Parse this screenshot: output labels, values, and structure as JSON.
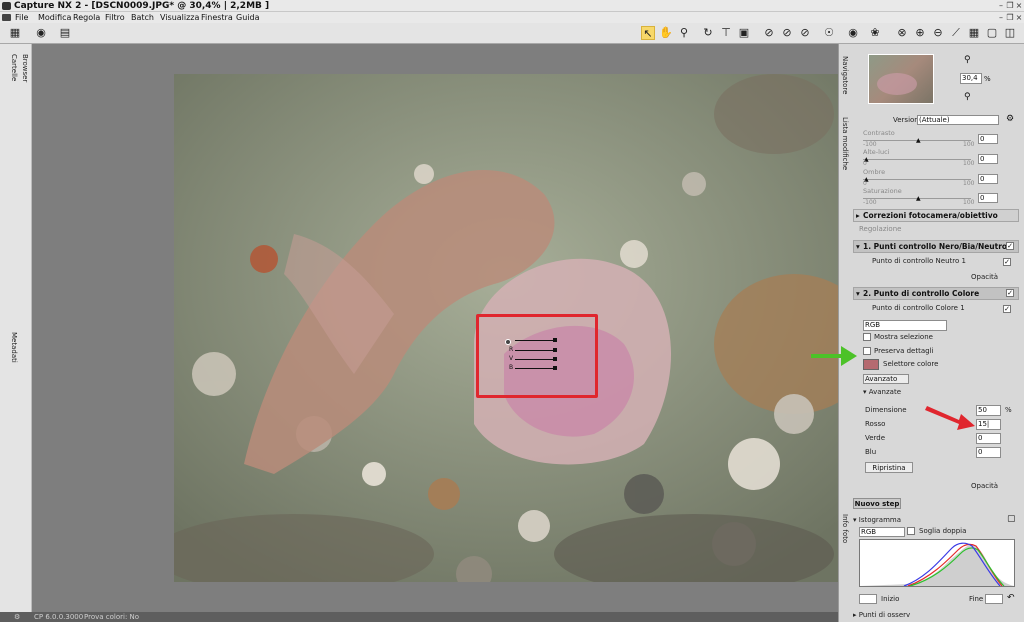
{
  "window": {
    "title": "Capture NX 2 - [DSCN0009.JPG* @ 30,4% | 2,2MB ]"
  },
  "menu": [
    "File",
    "Modifica",
    "Regola",
    "Filtro",
    "Batch",
    "Visualizza",
    "Finestra",
    "Guida"
  ],
  "left_strip": {
    "browser": "Browser",
    "cartelle": "Cartelle",
    "metadata": "Metadati"
  },
  "navigator": {
    "label": "Navigatore",
    "zoom_value": "30,4",
    "zoom_unit": "%"
  },
  "edit_list": {
    "label": "Lista modifiche",
    "version_label": "Versione:",
    "version_value": "(Attuale)",
    "sliders": [
      {
        "label": "Contrasto",
        "min": "-100",
        "max": "100",
        "value": "0"
      },
      {
        "label": "Alte-luci",
        "min": "0",
        "max": "100",
        "value": "0"
      },
      {
        "label": "Ombre",
        "min": "0",
        "max": "100",
        "value": "0"
      },
      {
        "label": "Saturazione",
        "min": "-100",
        "max": "100",
        "value": "0"
      }
    ],
    "lens_section": "Correzioni fotocamera/obiettivo",
    "adjust_label": "Regolazione",
    "step1": {
      "title": "1. Punti controllo Nero/Bia/Neutro",
      "item": "Punto di controllo Neutro 1",
      "opacity": "Opacità"
    },
    "step2": {
      "title": "2. Punto di controllo Colore",
      "item": "Punto di controllo Colore 1",
      "color_mode": "RGB",
      "show_selection": "Mostra selezione",
      "preserve_details": "Preserva dettagli",
      "color_picker": "Selettore colore",
      "advanced_dropdown": "Avanzato",
      "advanced_section": "Avanzate",
      "fields": [
        {
          "label": "Dimensione",
          "value": "50",
          "unit": "%"
        },
        {
          "label": "Rosso",
          "value": "15|",
          "unit": ""
        },
        {
          "label": "Verde",
          "value": "0",
          "unit": ""
        },
        {
          "label": "Blu",
          "value": "0",
          "unit": ""
        }
      ],
      "reset_button": "Ripristina",
      "opacity": "Opacità"
    },
    "new_step": "Nuovo step"
  },
  "info": {
    "label": "Info foto",
    "histogram": "Istogramma",
    "channel": "RGB",
    "split_view": "Soglia doppia",
    "start_label": "Inizio",
    "end_label": "Fine",
    "points_section": "Punti di osserv"
  },
  "control_point": {
    "letters": [
      "R",
      "V",
      "B"
    ]
  },
  "status": {
    "left": "CP 6.0.0.3000",
    "right": "Prova colori: No"
  },
  "colors": {
    "accent_red": "#e0262e",
    "arrow_green": "#4cc228",
    "swatch": "#b56a70",
    "panel_bg": "#d8d8d8"
  },
  "icons": [
    "select-tool-icon",
    "hand-tool-icon",
    "zoom-tool-icon",
    "rotate-icon",
    "straighten-icon",
    "crop-icon",
    "control-point-black-icon",
    "control-point-white-icon",
    "control-point-neutral-icon",
    "red-eye-icon",
    "lasso-icon",
    "brush-icon",
    "gradient-icon"
  ]
}
